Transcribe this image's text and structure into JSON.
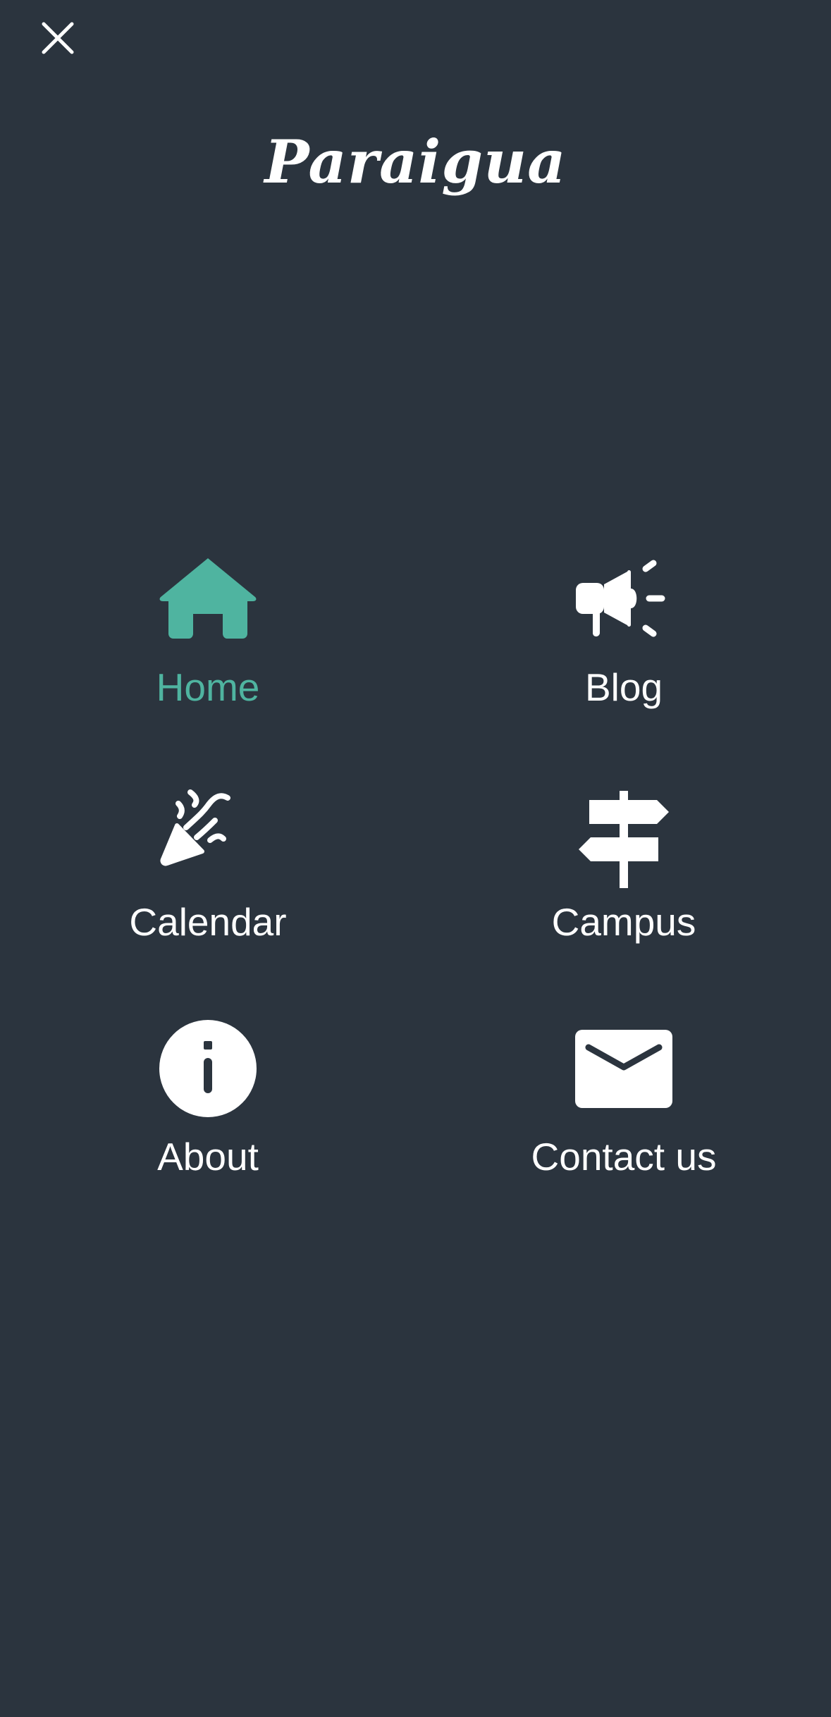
{
  "header": {
    "close_icon": "close-icon",
    "brand_name": "Paraigua"
  },
  "nav": {
    "items": [
      {
        "label": "Home",
        "icon": "home-icon",
        "active": true
      },
      {
        "label": "Blog",
        "icon": "megaphone-icon",
        "active": false
      },
      {
        "label": "Calendar",
        "icon": "party-popper-icon",
        "active": false
      },
      {
        "label": "Campus",
        "icon": "signpost-icon",
        "active": false
      },
      {
        "label": "About",
        "icon": "info-icon",
        "active": false
      },
      {
        "label": "Contact us",
        "icon": "envelope-icon",
        "active": false
      }
    ]
  },
  "colors": {
    "background": "#2b343e",
    "accent": "#4fb4a0",
    "text": "#ffffff"
  }
}
